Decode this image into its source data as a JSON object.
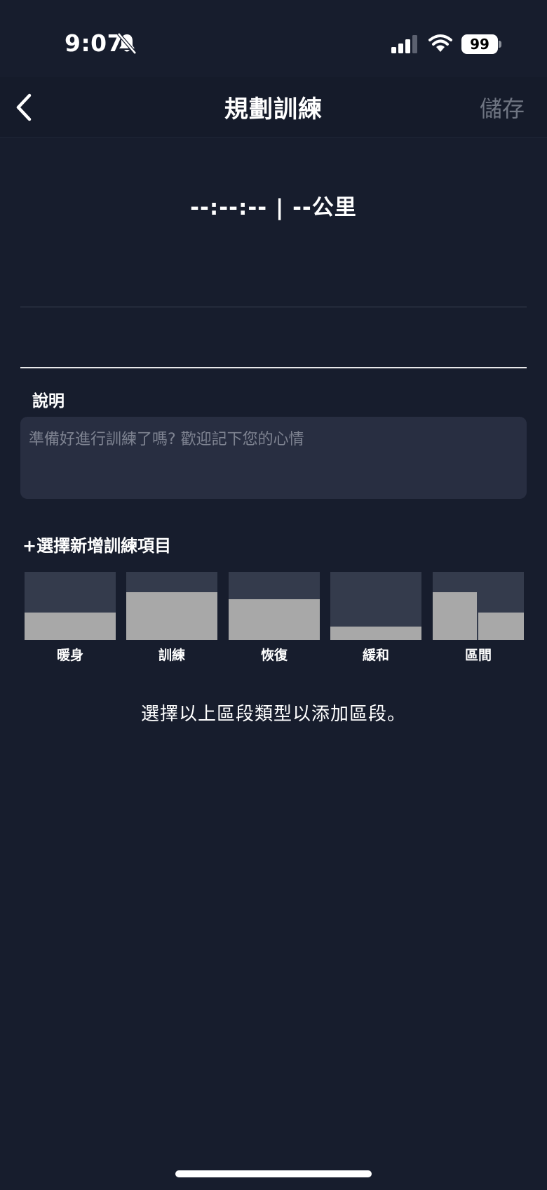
{
  "status_bar": {
    "time": "9:07",
    "battery": "99",
    "icons": [
      "bell-slash-icon",
      "signal-icon",
      "wifi-icon",
      "battery-icon"
    ]
  },
  "nav": {
    "title": "規劃訓練",
    "save_label": "儲存",
    "back_icon": "chevron-left-icon"
  },
  "summary": {
    "text": "--:--:-- | --公里"
  },
  "description": {
    "label": "說明",
    "placeholder": "準備好進行訓練了嗎? 歡迎記下您的心情"
  },
  "add_section": {
    "title": "+選擇新增訓練項目"
  },
  "segments": [
    {
      "label": "暖身",
      "icon": "warmup-segment-icon",
      "level": 0.4
    },
    {
      "label": "訓練",
      "icon": "training-segment-icon",
      "level": 0.7
    },
    {
      "label": "恢復",
      "icon": "recovery-segment-icon",
      "level": 0.6
    },
    {
      "label": "緩和",
      "icon": "cooldown-segment-icon",
      "level": 0.2
    },
    {
      "label": "區間",
      "icon": "interval-segment-icon",
      "levels": [
        0.7,
        0.4
      ]
    }
  ],
  "hint": "選擇以上區段類型以添加區段。",
  "colors": {
    "background": "#171d2d",
    "panel": "#282e41",
    "segment_bg": "#343b4c",
    "segment_fill": "#a8a8a8",
    "save_disabled": "#6f7582"
  }
}
